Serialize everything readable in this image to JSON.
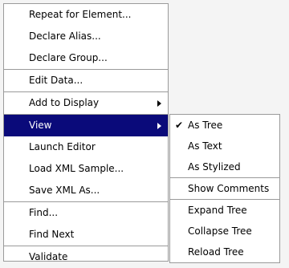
{
  "main_menu": {
    "groups": [
      {
        "items": [
          {
            "label": "Repeat for Element..."
          },
          {
            "label": "Declare Alias..."
          },
          {
            "label": "Declare Group..."
          }
        ]
      },
      {
        "items": [
          {
            "label": "Edit Data..."
          }
        ]
      },
      {
        "items": [
          {
            "label": "Add to Display"
          }
        ]
      },
      {
        "items": [
          {
            "label": "View"
          },
          {
            "label": "Launch Editor"
          },
          {
            "label": "Load XML Sample..."
          },
          {
            "label": "Save XML As..."
          }
        ]
      },
      {
        "items": [
          {
            "label": "Find..."
          },
          {
            "label": "Find Next"
          }
        ]
      },
      {
        "items": [
          {
            "label": "Validate"
          }
        ]
      }
    ]
  },
  "view_submenu": {
    "check_glyph": "✔",
    "groups": [
      {
        "items": [
          {
            "label": "As Tree",
            "checked": true
          },
          {
            "label": "As Text"
          },
          {
            "label": "As Stylized"
          }
        ]
      },
      {
        "items": [
          {
            "label": "Show Comments"
          }
        ]
      },
      {
        "items": [
          {
            "label": "Expand Tree"
          },
          {
            "label": "Collapse Tree"
          },
          {
            "label": "Reload Tree"
          }
        ]
      }
    ]
  },
  "colors": {
    "selected_bg": "#0a0a7a",
    "selected_fg": "#ffffff",
    "border": "#9a9a9a",
    "background": "#f4f4f4"
  }
}
